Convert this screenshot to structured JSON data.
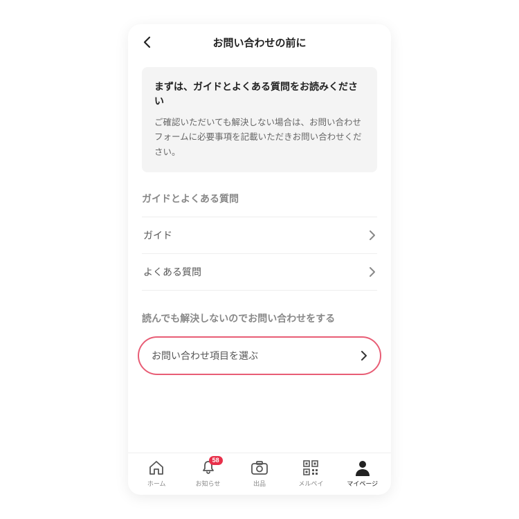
{
  "header": {
    "title": "お問い合わせの前に"
  },
  "info_card": {
    "title": "まずは、ガイドとよくある質問をお読みください",
    "body": "ご確認いただいても解決しない場合は、お問い合わせフォームに必要事項を記載いただきお問い合わせください。"
  },
  "section_faq": {
    "title": "ガイドとよくある質問",
    "rows": [
      {
        "label": "ガイド"
      },
      {
        "label": "よくある質問"
      }
    ]
  },
  "section_contact": {
    "title": "読んでも解決しないのでお問い合わせをする",
    "row": {
      "label": "お問い合わせ項目を選ぶ"
    }
  },
  "tabbar": {
    "home": "ホーム",
    "notice": "お知らせ",
    "notice_badge": "58",
    "listing": "出品",
    "merpay": "メルペイ",
    "mypage": "マイページ"
  },
  "colors": {
    "highlight": "#e85d75",
    "badge": "#e8304a"
  }
}
